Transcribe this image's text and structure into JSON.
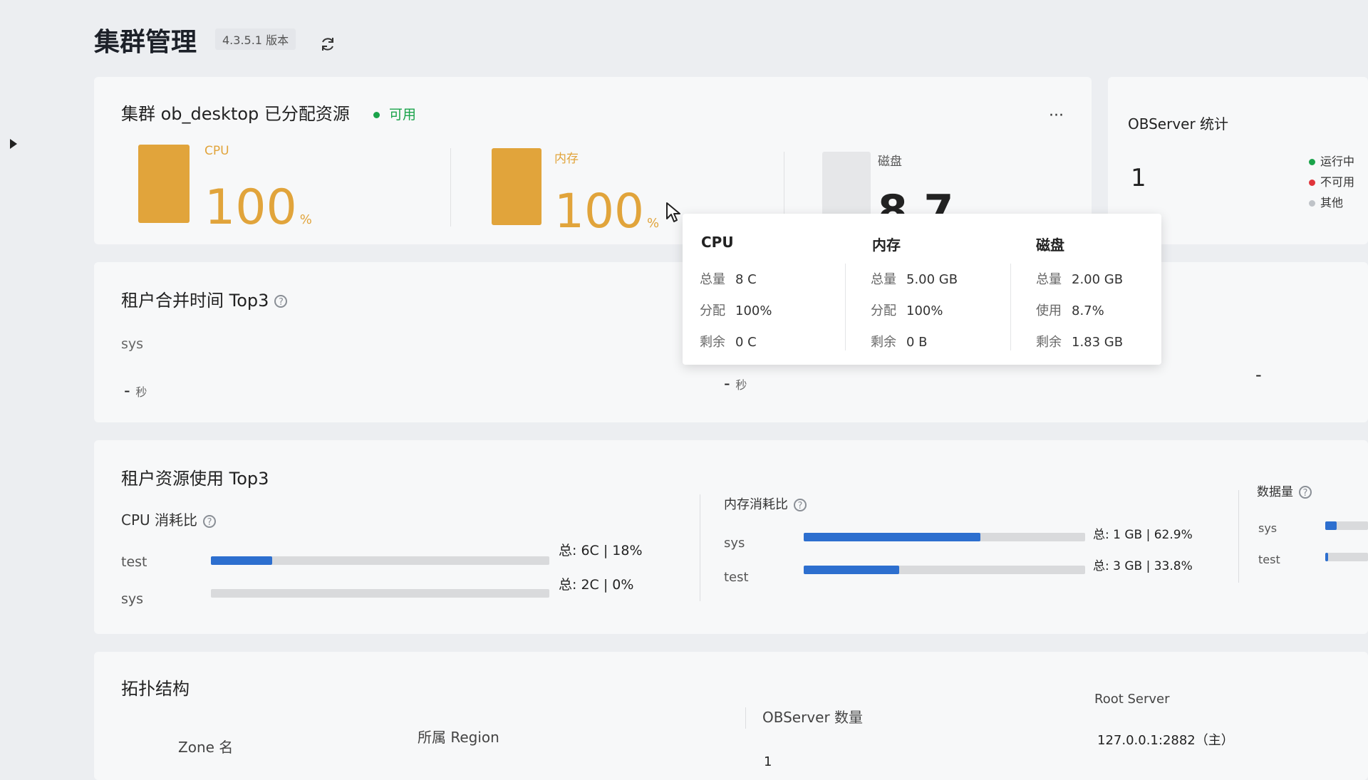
{
  "header": {
    "title": "集群管理",
    "version": "4.3.5.1 版本"
  },
  "cluster_card": {
    "title": "集群 ob_desktop 已分配资源",
    "status": "可用",
    "status_color": "#1aa34a",
    "more_label": "···",
    "accent_color": "#e1a43b",
    "cpu": {
      "label": "CPU",
      "value": "100",
      "unit": "%",
      "fill_percent": 100
    },
    "memory": {
      "label": "内存",
      "value": "100",
      "unit": "%",
      "fill_percent": 100
    },
    "disk": {
      "label": "磁盘",
      "value": "8.7",
      "fill_percent": 8.7
    }
  },
  "tooltip": {
    "columns": [
      {
        "title": "CPU",
        "rows": [
          {
            "k": "总量",
            "v": "8 C"
          },
          {
            "k": "分配",
            "v": "100%"
          },
          {
            "k": "剩余",
            "v": "0 C"
          }
        ]
      },
      {
        "title": "内存",
        "rows": [
          {
            "k": "总量",
            "v": "5.00 GB"
          },
          {
            "k": "分配",
            "v": "100%"
          },
          {
            "k": "剩余",
            "v": "0 B"
          }
        ]
      },
      {
        "title": "磁盘",
        "rows": [
          {
            "k": "总量",
            "v": "2.00 GB"
          },
          {
            "k": "使用",
            "v": "8.7%"
          },
          {
            "k": "剩余",
            "v": "1.83 GB"
          }
        ]
      }
    ]
  },
  "observer": {
    "title": "OBServer 统计",
    "count": "1",
    "legend": [
      {
        "label": "运行中",
        "color": "#1aa34a"
      },
      {
        "label": "不可用",
        "color": "#e0343a"
      },
      {
        "label": "其他",
        "color": "#bfc3c8"
      }
    ]
  },
  "merge_card": {
    "title": "租户合并时间 Top3",
    "tenant": "sys",
    "value_left": "-",
    "unit_left": "秒",
    "value_mid": "-",
    "unit_mid": "秒",
    "value_right": "-"
  },
  "resource_card": {
    "title": "租户资源使用 Top3",
    "cpu": {
      "title": "CPU 消耗比",
      "rows": [
        {
          "name": "test",
          "summary": "总: 6C | 18%",
          "percent": 18
        },
        {
          "name": "sys",
          "summary": "总: 2C | 0%",
          "percent": 0
        }
      ]
    },
    "memory": {
      "title": "内存消耗比",
      "rows": [
        {
          "name": "sys",
          "summary": "总: 1 GB | 62.9%",
          "percent": 62.9
        },
        {
          "name": "test",
          "summary": "总: 3 GB | 33.8%",
          "percent": 33.8
        }
      ]
    },
    "data": {
      "title": "数据量",
      "rows": [
        {
          "name": "sys"
        },
        {
          "name": "test"
        }
      ]
    }
  },
  "topology": {
    "title": "拓扑结构",
    "columns": [
      "Zone 名",
      "所属 Region",
      "OBServer 数量",
      "Root Server"
    ],
    "row": {
      "observer_count": "1",
      "root_server": "127.0.0.1:2882（主）"
    }
  }
}
